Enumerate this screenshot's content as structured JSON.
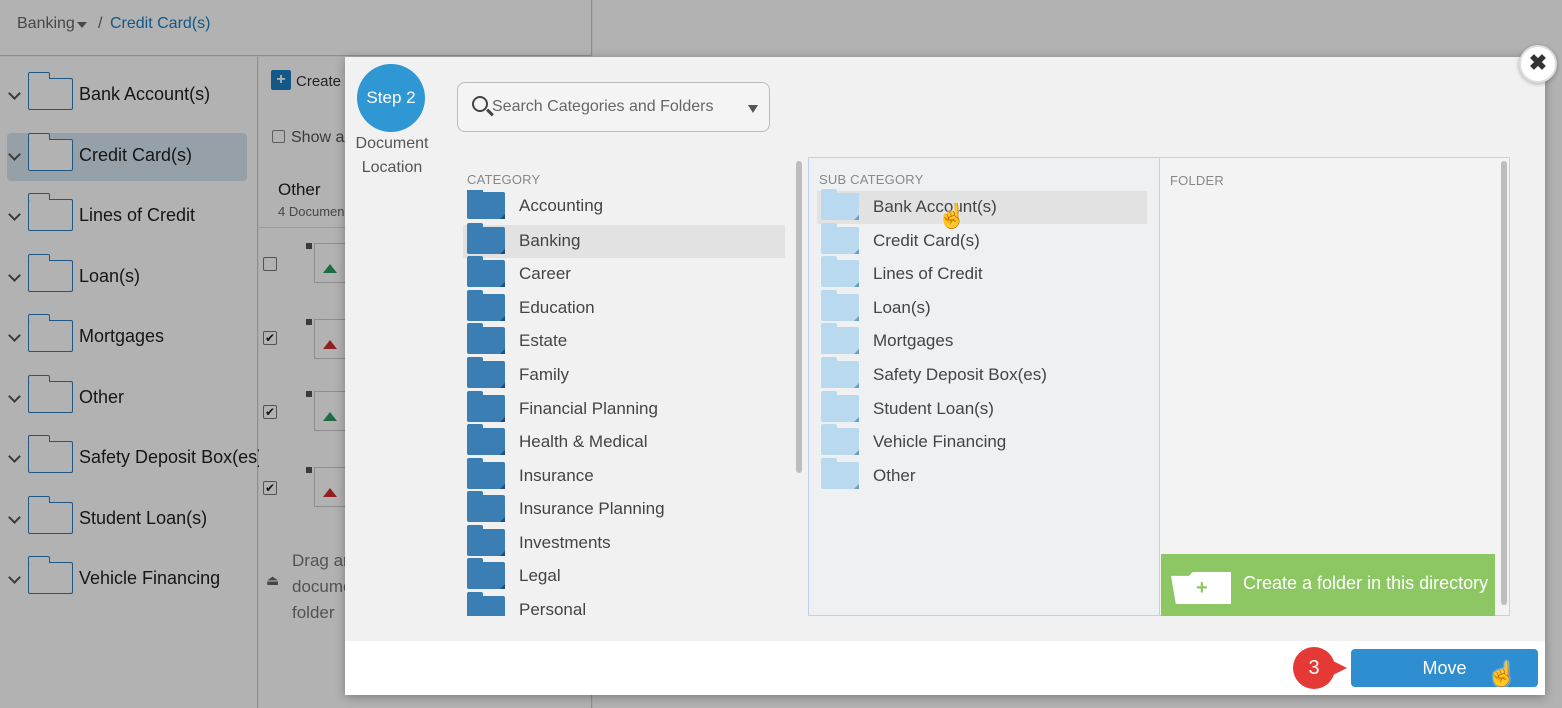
{
  "breadcrumb": {
    "parent": "Banking",
    "separator": "/",
    "current": "Credit Card(s)"
  },
  "tree": {
    "items": [
      {
        "label": "Bank Account(s)",
        "selected": false
      },
      {
        "label": "Credit Card(s)",
        "selected": true
      },
      {
        "label": "Lines of Credit",
        "selected": false
      },
      {
        "label": "Loan(s)",
        "selected": false
      },
      {
        "label": "Mortgages",
        "selected": false
      },
      {
        "label": "Other",
        "selected": false
      },
      {
        "label": "Safety Deposit Box(es)",
        "selected": false
      },
      {
        "label": "Student Loan(s)",
        "selected": false
      },
      {
        "label": "Vehicle Financing",
        "selected": false
      }
    ]
  },
  "middle": {
    "create_label": "Create f",
    "show_label": "Show a",
    "section_title": "Other",
    "section_sub": "4 Documen",
    "drag_text": "Drag ar docume folder"
  },
  "modal": {
    "step_label": "Step 2",
    "step_caption": "Document Location",
    "search": {
      "placeholder": "Search Categories and Folders",
      "value": ""
    },
    "category": {
      "header": "CATEGORY",
      "items": [
        "Accounting",
        "Banking",
        "Career",
        "Education",
        "Estate",
        "Family",
        "Financial Planning",
        "Health & Medical",
        "Insurance",
        "Insurance Planning",
        "Investments",
        "Legal",
        "Personal"
      ],
      "selected": "Banking"
    },
    "sub_category": {
      "header": "SUB CATEGORY",
      "items": [
        "Bank Account(s)",
        "Credit Card(s)",
        "Lines of Credit",
        "Loan(s)",
        "Mortgages",
        "Safety Deposit Box(es)",
        "Student Loan(s)",
        "Vehicle Financing",
        "Other"
      ],
      "hovered": "Bank Account(s)"
    },
    "folder": {
      "header": "FOLDER"
    },
    "create_folder_label": "Create a folder in this directory",
    "move_label": "Move",
    "step_badge": "3",
    "close_symbol": "✖"
  },
  "colors": {
    "accent": "#2f8ecf",
    "create_folder": "#8dc764",
    "badge": "#e53935",
    "step_circle": "#2f97d3"
  }
}
